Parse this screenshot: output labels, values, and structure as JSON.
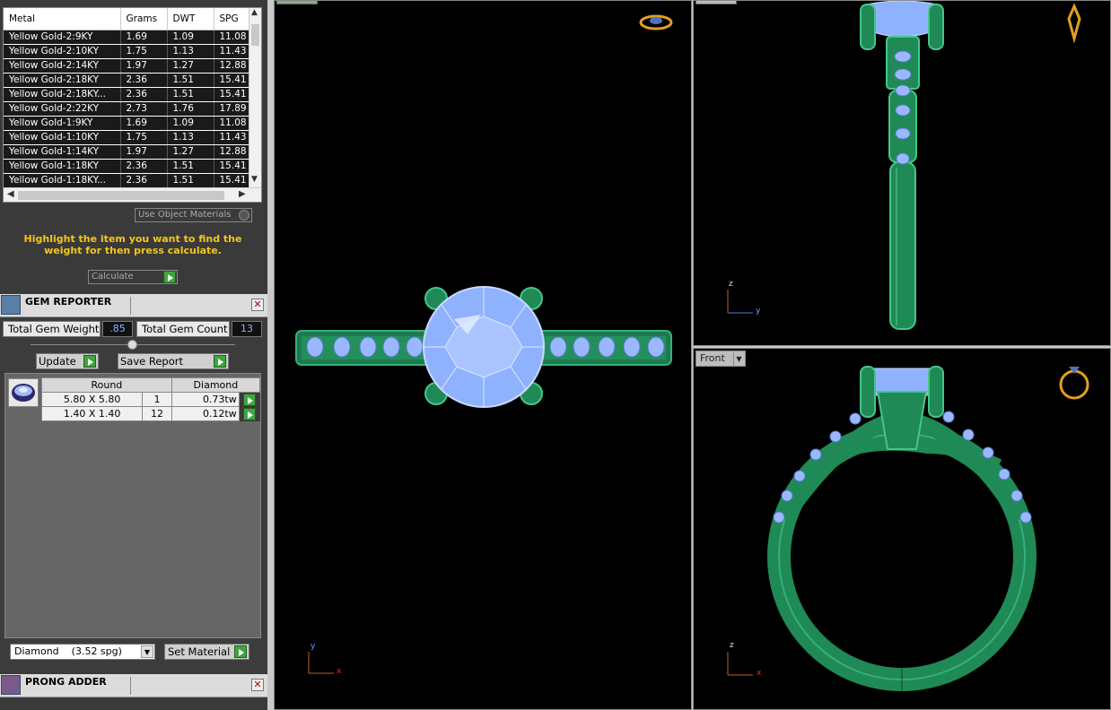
{
  "metal_table": {
    "columns": [
      "Metal",
      "Grams",
      "DWT",
      "SPG"
    ],
    "rows": [
      [
        "Yellow Gold-2:9KY",
        "1.69",
        "1.09",
        "11.08"
      ],
      [
        "Yellow Gold-2:10KY",
        "1.75",
        "1.13",
        "11.43"
      ],
      [
        "Yellow Gold-2:14KY",
        "1.97",
        "1.27",
        "12.88"
      ],
      [
        "Yellow Gold-2:18KY",
        "2.36",
        "1.51",
        "15.41"
      ],
      [
        "Yellow Gold-2:18KY...",
        "2.36",
        "1.51",
        "15.41"
      ],
      [
        "Yellow Gold-2:22KY",
        "2.73",
        "1.76",
        "17.89"
      ],
      [
        "Yellow Gold-1:9KY",
        "1.69",
        "1.09",
        "11.08"
      ],
      [
        "Yellow Gold-1:10KY",
        "1.75",
        "1.13",
        "11.43"
      ],
      [
        "Yellow Gold-1:14KY",
        "1.97",
        "1.27",
        "12.88"
      ],
      [
        "Yellow Gold-1:18KY",
        "2.36",
        "1.51",
        "15.41"
      ],
      [
        "Yellow Gold-1:18KY...",
        "2.36",
        "1.51",
        "15.41"
      ]
    ]
  },
  "use_object_materials": "Use Object Materials",
  "hint": "Highlight the item you want to find the weight for then press calculate.",
  "calculate_label": "Calculate",
  "gem_reporter": {
    "title": "GEM REPORTER",
    "total_weight_label": "Total Gem Weight",
    "total_weight_value": ".85",
    "total_count_label": "Total Gem Count",
    "total_count_value": "13",
    "update_label": "Update",
    "save_report_label": "Save Report",
    "table_headers": [
      "Round",
      "Diamond"
    ],
    "gems": [
      {
        "size": "5.80 X 5.80",
        "count": "1",
        "weight": "0.73tw"
      },
      {
        "size": "1.40 X 1.40",
        "count": "12",
        "weight": "0.12tw"
      }
    ],
    "material": "Diamond    (3.52 spg)",
    "set_material_label": "Set Material"
  },
  "prong_adder": {
    "title": "PRONG ADDER"
  },
  "viewports": {
    "front_label": "Front",
    "axes": {
      "top": [
        "y",
        "x"
      ],
      "right": [
        "z",
        "y"
      ],
      "front": [
        "z",
        "x"
      ]
    }
  },
  "colors": {
    "metal": "#2a9060",
    "gem": "#8ab4ff",
    "accent": "#f5c518"
  }
}
